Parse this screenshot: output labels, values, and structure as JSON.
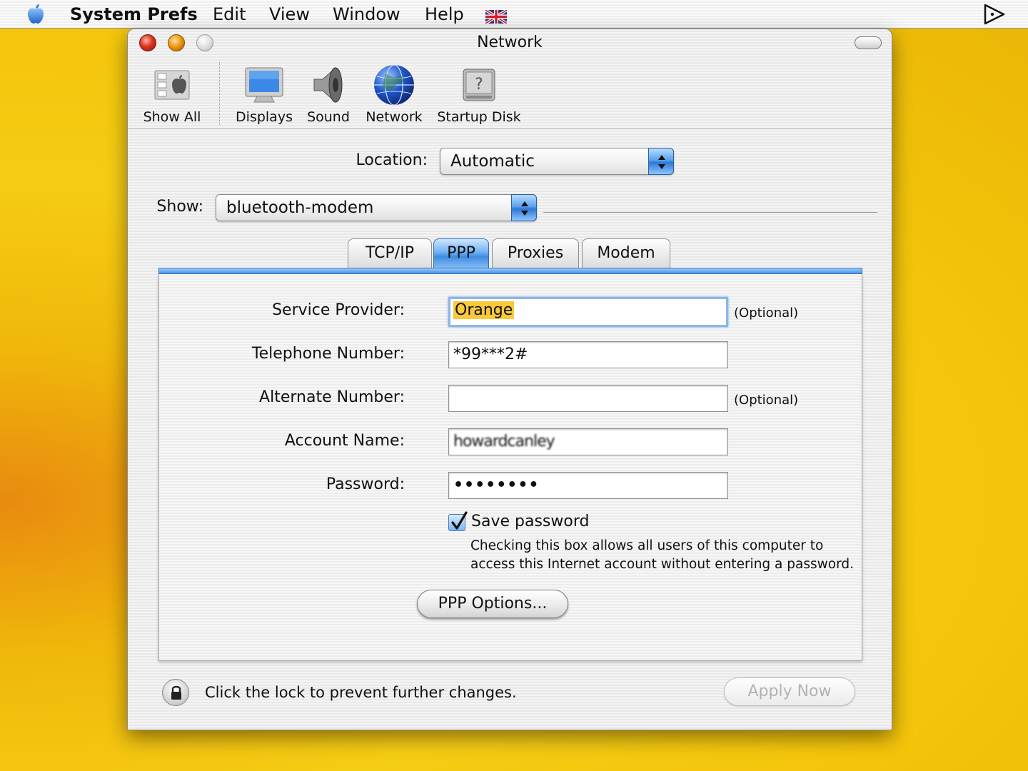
{
  "menubar": {
    "app_name": "System Prefs",
    "items": [
      "Edit",
      "View",
      "Window",
      "Help"
    ],
    "icons": [
      "apple-icon",
      "flag-icon",
      "script-icon"
    ]
  },
  "window": {
    "title": "Network"
  },
  "toolbar": {
    "items": [
      {
        "label": "Show All",
        "icon": "show-all-icon"
      },
      {
        "label": "Displays",
        "icon": "displays-icon"
      },
      {
        "label": "Sound",
        "icon": "sound-icon"
      },
      {
        "label": "Network",
        "icon": "network-icon"
      },
      {
        "label": "Startup Disk",
        "icon": "startup-disk-icon"
      }
    ]
  },
  "location": {
    "label": "Location:",
    "value": "Automatic"
  },
  "show": {
    "label": "Show:",
    "value": "bluetooth-modem"
  },
  "tabs": [
    {
      "label": "TCP/IP",
      "active": false
    },
    {
      "label": "PPP",
      "active": true
    },
    {
      "label": "Proxies",
      "active": false
    },
    {
      "label": "Modem",
      "active": false
    }
  ],
  "form": {
    "service_provider": {
      "label": "Service Provider:",
      "value": "Orange",
      "hint": "(Optional)"
    },
    "telephone_number": {
      "label": "Telephone Number:",
      "value": "*99***2#"
    },
    "alternate_number": {
      "label": "Alternate Number:",
      "value": "",
      "hint": "(Optional)"
    },
    "account_name": {
      "label": "Account Name:",
      "value": "howardcanley"
    },
    "password": {
      "label": "Password:",
      "value": "••••••••"
    },
    "save_password": {
      "label": "Save password",
      "checked": true
    },
    "help_line_1": "Checking this box allows all users of this computer to",
    "help_line_2": "access this Internet account without entering a password.",
    "ppp_options_label": "PPP Options..."
  },
  "footer": {
    "lock_text": "Click the lock to prevent further changes.",
    "apply_label": "Apply Now"
  },
  "colors": {
    "accent": "#3f8be0",
    "selection": "#f9c93a",
    "desktop": "#f3c40a"
  }
}
